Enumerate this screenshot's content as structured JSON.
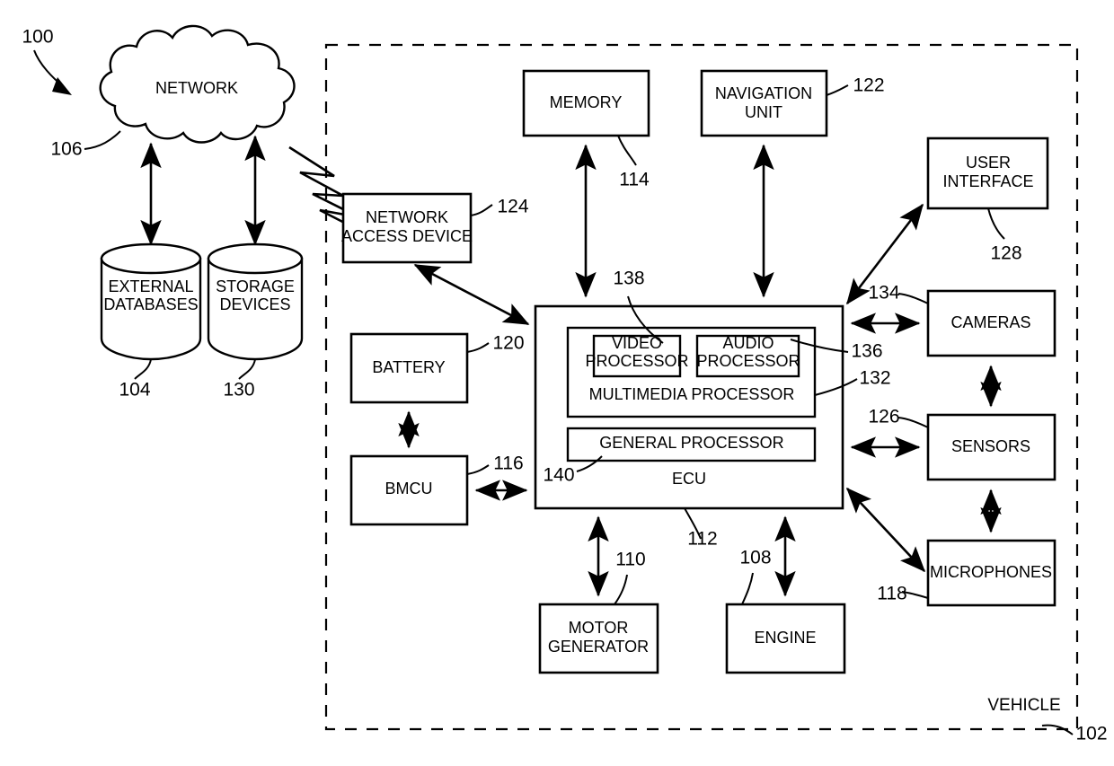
{
  "figure": {
    "title": "Vehicle system block diagram",
    "figure_reference": "100",
    "boundary_label": "VEHICLE",
    "boundary_reference": "102",
    "background_color": "#ffffff",
    "line_color": "#000000"
  },
  "nodes": {
    "network": {
      "label": "NETWORK",
      "reference": "106",
      "shape": "cloud"
    },
    "external_databases": {
      "label_line1": "EXTERNAL",
      "label_line2": "DATABASES",
      "reference": "104",
      "shape": "cylinder"
    },
    "storage_devices": {
      "label_line1": "STORAGE",
      "label_line2": "DEVICES",
      "reference": "130",
      "shape": "cylinder"
    },
    "network_access_device": {
      "label_line1": "NETWORK",
      "label_line2": "ACCESS DEVICE",
      "reference": "124",
      "shape": "rect"
    },
    "memory": {
      "label": "MEMORY",
      "reference": "114",
      "shape": "rect"
    },
    "navigation_unit": {
      "label_line1": "NAVIGATION",
      "label_line2": "UNIT",
      "reference": "122",
      "shape": "rect"
    },
    "user_interface": {
      "label_line1": "USER",
      "label_line2": "INTERFACE",
      "reference": "128",
      "shape": "rect"
    },
    "cameras": {
      "label": "CAMERAS",
      "reference": "134",
      "shape": "rect"
    },
    "sensors": {
      "label": "SENSORS",
      "reference": "126",
      "shape": "rect"
    },
    "microphones": {
      "label": "MICROPHONES",
      "reference": "118",
      "shape": "rect"
    },
    "battery": {
      "label": "BATTERY",
      "reference": "120",
      "shape": "rect"
    },
    "bmcu": {
      "label": "BMCU",
      "reference": "116",
      "shape": "rect"
    },
    "motor_generator": {
      "label_line1": "MOTOR",
      "label_line2": "GENERATOR",
      "reference": "110",
      "shape": "rect"
    },
    "engine": {
      "label": "ENGINE",
      "reference": "108",
      "shape": "rect"
    },
    "ecu": {
      "label": "ECU",
      "reference": "112",
      "shape": "rect"
    },
    "multimedia_processor": {
      "label": "MULTIMEDIA PROCESSOR",
      "reference": "132",
      "shape": "rect"
    },
    "video_processor": {
      "label_line1": "VIDEO",
      "label_line2": "PROCESSOR",
      "reference": "138",
      "shape": "rect"
    },
    "audio_processor": {
      "label_line1": "AUDIO",
      "label_line2": "PROCESSOR",
      "reference": "136",
      "shape": "rect"
    },
    "general_processor": {
      "label": "GENERAL PROCESSOR",
      "reference": "140",
      "shape": "rect"
    }
  },
  "connections": [
    {
      "from": "network",
      "to": "external_databases",
      "style": "double-arrow",
      "orientation": "vertical"
    },
    {
      "from": "network",
      "to": "storage_devices",
      "style": "double-arrow",
      "orientation": "vertical"
    },
    {
      "from": "network",
      "to": "network_access_device",
      "style": "lightning-bolt",
      "orientation": "diagonal"
    },
    {
      "from": "network_access_device",
      "to": "ecu",
      "style": "double-arrow",
      "orientation": "diagonal"
    },
    {
      "from": "memory",
      "to": "ecu",
      "style": "double-arrow",
      "orientation": "vertical"
    },
    {
      "from": "navigation_unit",
      "to": "ecu",
      "style": "double-arrow",
      "orientation": "vertical"
    },
    {
      "from": "ecu",
      "to": "user_interface",
      "style": "double-arrow",
      "orientation": "diagonal"
    },
    {
      "from": "ecu",
      "to": "cameras",
      "style": "double-arrow",
      "orientation": "horizontal"
    },
    {
      "from": "ecu",
      "to": "sensors",
      "style": "double-arrow",
      "orientation": "horizontal"
    },
    {
      "from": "ecu",
      "to": "microphones",
      "style": "double-arrow",
      "orientation": "diagonal"
    },
    {
      "from": "cameras",
      "to": "sensors",
      "style": "double-arrow",
      "orientation": "vertical"
    },
    {
      "from": "sensors",
      "to": "microphones",
      "style": "double-arrow",
      "orientation": "vertical"
    },
    {
      "from": "battery",
      "to": "bmcu",
      "style": "double-arrow",
      "orientation": "vertical"
    },
    {
      "from": "bmcu",
      "to": "ecu",
      "style": "double-arrow",
      "orientation": "horizontal"
    },
    {
      "from": "ecu",
      "to": "motor_generator",
      "style": "double-arrow",
      "orientation": "vertical"
    },
    {
      "from": "ecu",
      "to": "engine",
      "style": "double-arrow",
      "orientation": "vertical"
    }
  ]
}
